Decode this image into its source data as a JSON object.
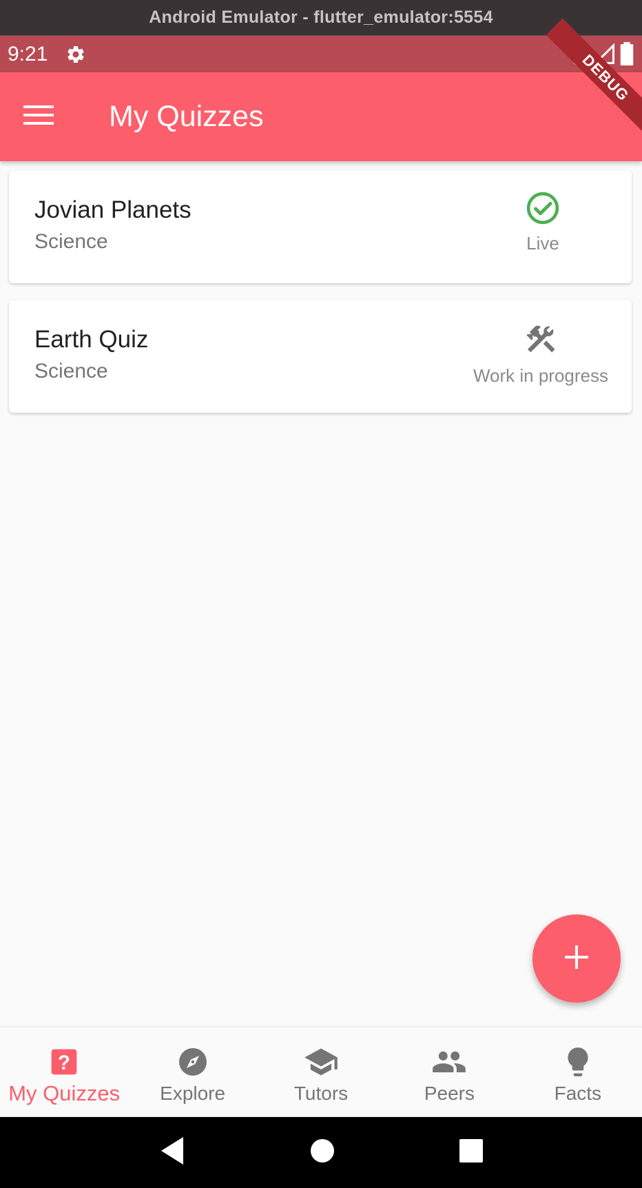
{
  "window": {
    "title": "Android Emulator - flutter_emulator:5554"
  },
  "status_bar": {
    "time": "9:21",
    "debug_label": "DEBUG"
  },
  "app_bar": {
    "title": "My Quizzes"
  },
  "quizzes": [
    {
      "title": "Jovian Planets",
      "category": "Science",
      "status": "Live",
      "status_icon": "check-circle-icon"
    },
    {
      "title": "Earth Quiz",
      "category": "Science",
      "status": "Work in progress",
      "status_icon": "hammer-wrench-icon"
    }
  ],
  "fab": {
    "icon": "plus-icon"
  },
  "bottom_nav": {
    "items": [
      {
        "label": "My Quizzes",
        "icon": "quiz-icon",
        "active": true
      },
      {
        "label": "Explore",
        "icon": "compass-icon",
        "active": false
      },
      {
        "label": "Tutors",
        "icon": "graduation-cap-icon",
        "active": false
      },
      {
        "label": "Peers",
        "icon": "people-icon",
        "active": false
      },
      {
        "label": "Facts",
        "icon": "lightbulb-icon",
        "active": false
      }
    ]
  },
  "colors": {
    "primary": "#fd5e6b",
    "status_bar": "#b74a52",
    "live_green": "#4caf50",
    "icon_grey": "#757575"
  }
}
